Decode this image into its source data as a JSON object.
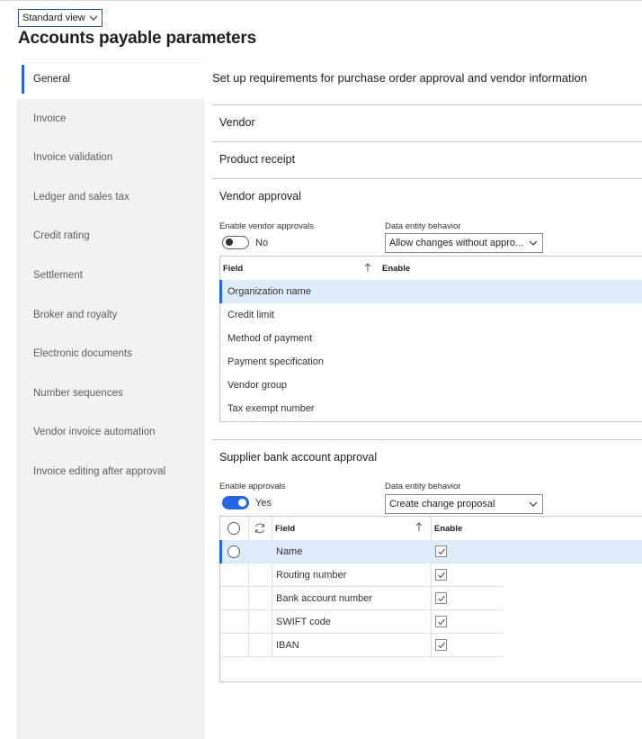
{
  "view_selector": {
    "label": "Standard view"
  },
  "page": {
    "title": "Accounts payable parameters"
  },
  "sidebar": {
    "items": [
      {
        "label": "General",
        "active": true
      },
      {
        "label": "Invoice"
      },
      {
        "label": "Invoice validation"
      },
      {
        "label": "Ledger and sales tax"
      },
      {
        "label": "Credit rating"
      },
      {
        "label": "Settlement"
      },
      {
        "label": "Broker and royalty"
      },
      {
        "label": "Electronic documents"
      },
      {
        "label": "Number sequences"
      },
      {
        "label": "Vendor invoice automation"
      },
      {
        "label": "Invoice editing after approval"
      }
    ]
  },
  "main": {
    "description": "Set up requirements for purchase order approval and vendor information",
    "fasttabs": {
      "vendor": "Vendor",
      "product_receipt": "Product receipt",
      "vendor_approval": "Vendor approval",
      "supplier_bank": "Supplier bank account approval"
    }
  },
  "vendor_approval": {
    "enable_label": "Enable vendor approvals",
    "enable_state": "No",
    "data_entity_label": "Data entity behavior",
    "data_entity_value": "Allow changes without appro...",
    "grid": {
      "col_field": "Field",
      "col_enable": "Enable",
      "rows": [
        {
          "field": "Organization name",
          "selected": true
        },
        {
          "field": "Credit limit"
        },
        {
          "field": "Method of payment"
        },
        {
          "field": "Payment specification"
        },
        {
          "field": "Vendor group"
        },
        {
          "field": "Tax exempt number"
        }
      ]
    }
  },
  "bank_approval": {
    "enable_label": "Enable approvals",
    "enable_state": "Yes",
    "data_entity_label": "Data entity behavior",
    "data_entity_value": "Create change proposal",
    "grid": {
      "col_field": "Field",
      "col_enable": "Enable",
      "rows": [
        {
          "field": "Name",
          "enabled": true,
          "selected": true
        },
        {
          "field": "Routing number",
          "enabled": true
        },
        {
          "field": "Bank account number",
          "enabled": true
        },
        {
          "field": "SWIFT code",
          "enabled": true
        },
        {
          "field": "IBAN",
          "enabled": true
        }
      ]
    }
  },
  "colors": {
    "accent": "#2266e3",
    "selected_row": "#deecf9",
    "sidebar_bg": "#f3f2f1"
  },
  "icons": [
    "chevron-down-icon",
    "sort-ascending-icon",
    "refresh-icon",
    "checkmark-icon"
  ]
}
